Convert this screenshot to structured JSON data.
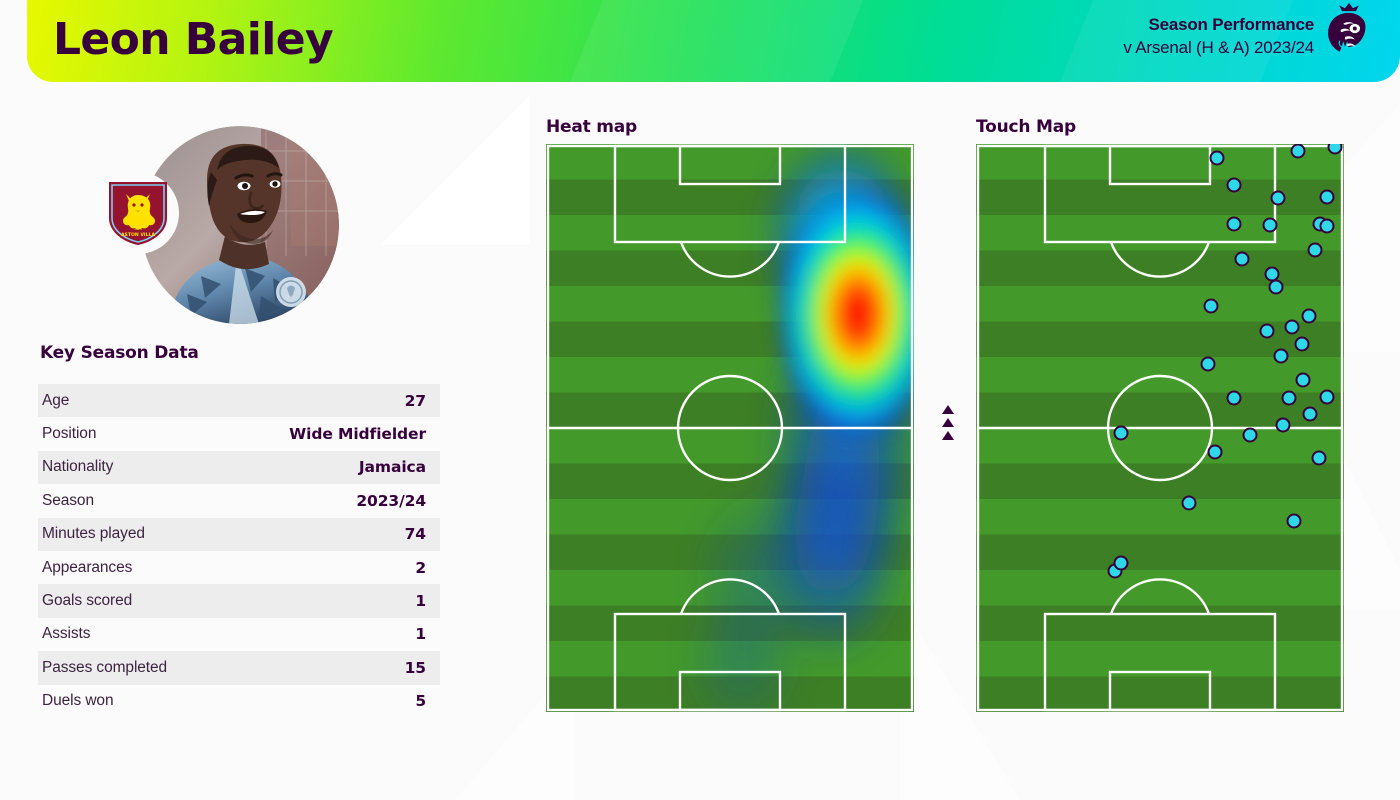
{
  "header": {
    "player_name": "Leon Bailey",
    "performance_title": "Season Performance",
    "performance_subtitle": "v Arsenal (H & A) 2023/24",
    "logo_icon": "premier-league-lion-icon",
    "gradient_start": "#e8f800",
    "gradient_mid": "#4ee632",
    "gradient_end": "#00d6ee",
    "text_color": "#37003c"
  },
  "player": {
    "photo_icon": "player-portrait",
    "club_badge_icon": "aston-villa-badge-icon",
    "club": "Aston Villa"
  },
  "stats": {
    "title": "Key Season Data",
    "rows": [
      {
        "label": "Age",
        "value": "27"
      },
      {
        "label": "Position",
        "value": "Wide Midfielder"
      },
      {
        "label": "Nationality",
        "value": "Jamaica"
      },
      {
        "label": "Season",
        "value": "2023/24"
      },
      {
        "label": "Minutes played",
        "value": "74"
      },
      {
        "label": "Appearances",
        "value": "2"
      },
      {
        "label": "Goals scored",
        "value": "1"
      },
      {
        "label": "Assists",
        "value": "1"
      },
      {
        "label": "Passes completed",
        "value": "15"
      },
      {
        "label": "Duels won",
        "value": "5"
      }
    ]
  },
  "heatmap": {
    "title": "Heat map"
  },
  "touchmap": {
    "title": "Touch Map"
  },
  "direction": {
    "arrow_icon": "attack-direction-arrow",
    "count": 3
  },
  "chart_data": [
    {
      "type": "heatmap",
      "title": "Heat map",
      "xlabel": "",
      "ylabel": "",
      "orientation": "vertical-pitch",
      "attack_direction": "up",
      "colormap": [
        "#0000bf",
        "#0040ff",
        "#00bfff",
        "#00ff80",
        "#bfff00",
        "#ffbf00",
        "#ff3000",
        "#ff0000"
      ],
      "pitch_color_light": "#439a2a",
      "pitch_color_dark": "#3d7f24",
      "grid": false,
      "note": "Density concentrated on the right flank; peak intensity in the right half-space just outside the attacking penalty area",
      "hotspots": [
        {
          "x": 0.86,
          "y": 0.3,
          "intensity": 1.0
        },
        {
          "x": 0.84,
          "y": 0.12,
          "intensity": 0.55
        },
        {
          "x": 0.82,
          "y": 0.52,
          "intensity": 0.45
        },
        {
          "x": 0.78,
          "y": 0.7,
          "intensity": 0.3
        },
        {
          "x": 0.55,
          "y": 0.85,
          "intensity": 0.18
        },
        {
          "x": 0.5,
          "y": 0.95,
          "intensity": 0.12
        }
      ]
    },
    {
      "type": "scatter",
      "title": "Touch Map",
      "xlabel": "",
      "ylabel": "",
      "orientation": "vertical-pitch",
      "attack_direction": "up",
      "marker_fill": "#2ed8e6",
      "marker_stroke": "#37003c",
      "xlim": [
        0,
        1
      ],
      "ylim": [
        0,
        1
      ],
      "grid": false,
      "points": [
        {
          "x": 0.655,
          "y": 0.025
        },
        {
          "x": 0.875,
          "y": 0.013
        },
        {
          "x": 0.975,
          "y": 0.006
        },
        {
          "x": 0.7,
          "y": 0.072
        },
        {
          "x": 0.82,
          "y": 0.095
        },
        {
          "x": 0.955,
          "y": 0.093
        },
        {
          "x": 0.7,
          "y": 0.14
        },
        {
          "x": 0.8,
          "y": 0.143
        },
        {
          "x": 0.935,
          "y": 0.14
        },
        {
          "x": 0.955,
          "y": 0.145
        },
        {
          "x": 0.922,
          "y": 0.186
        },
        {
          "x": 0.722,
          "y": 0.202
        },
        {
          "x": 0.805,
          "y": 0.228
        },
        {
          "x": 0.815,
          "y": 0.252
        },
        {
          "x": 0.638,
          "y": 0.285
        },
        {
          "x": 0.905,
          "y": 0.303
        },
        {
          "x": 0.79,
          "y": 0.33
        },
        {
          "x": 0.86,
          "y": 0.323
        },
        {
          "x": 0.885,
          "y": 0.352
        },
        {
          "x": 0.828,
          "y": 0.374
        },
        {
          "x": 0.63,
          "y": 0.388
        },
        {
          "x": 0.888,
          "y": 0.415
        },
        {
          "x": 0.7,
          "y": 0.447
        },
        {
          "x": 0.85,
          "y": 0.447
        },
        {
          "x": 0.955,
          "y": 0.445
        },
        {
          "x": 0.908,
          "y": 0.475
        },
        {
          "x": 0.395,
          "y": 0.508
        },
        {
          "x": 0.745,
          "y": 0.512
        },
        {
          "x": 0.835,
          "y": 0.495
        },
        {
          "x": 0.65,
          "y": 0.543
        },
        {
          "x": 0.932,
          "y": 0.552
        },
        {
          "x": 0.578,
          "y": 0.632
        },
        {
          "x": 0.865,
          "y": 0.663
        },
        {
          "x": 0.378,
          "y": 0.752
        },
        {
          "x": 0.395,
          "y": 0.738
        }
      ]
    }
  ]
}
